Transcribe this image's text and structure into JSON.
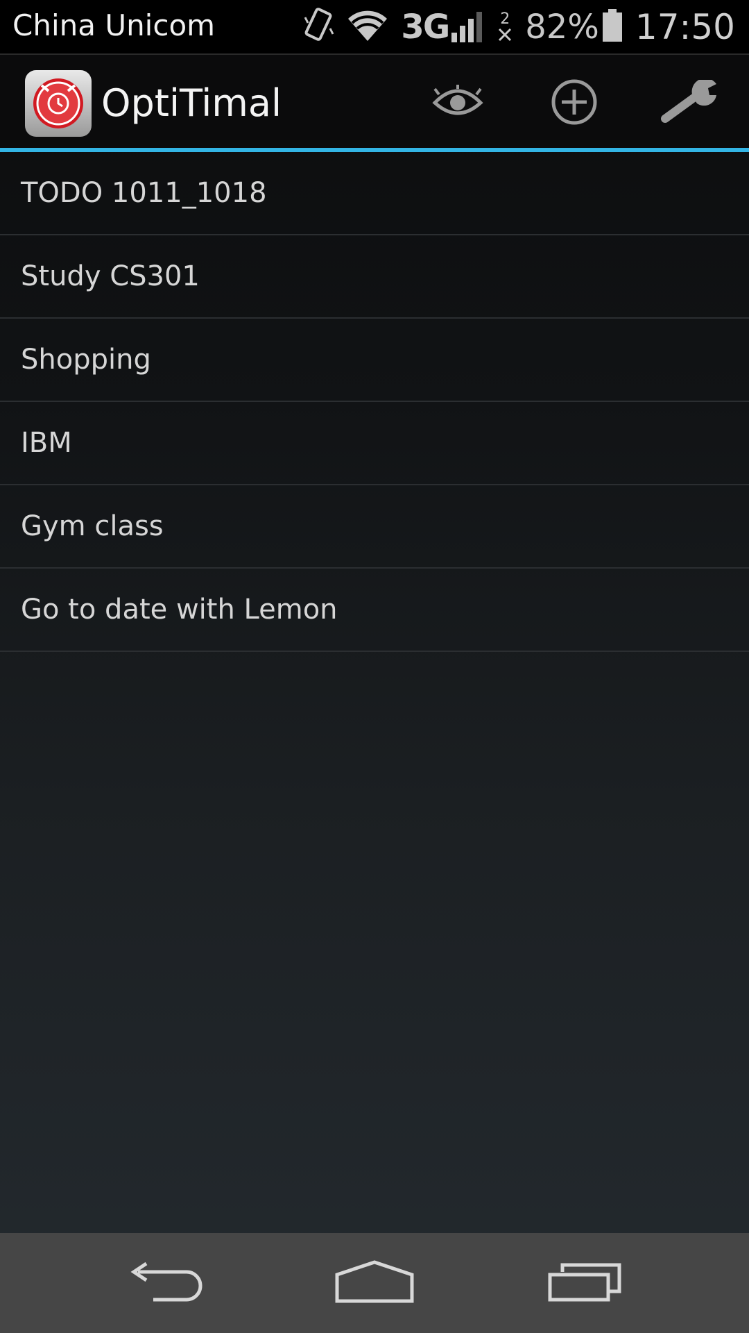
{
  "status_bar": {
    "carrier": "China Unicom",
    "network": "3G",
    "sim2_label": "2",
    "battery": "82%",
    "time": "17:50",
    "icons": [
      "vibrate-icon",
      "wifi-icon",
      "signal-icon",
      "sim2-no-signal-icon",
      "battery-icon"
    ]
  },
  "action_bar": {
    "title": "OptiTimal",
    "logo": "alarm-clock-logo",
    "actions": [
      "eye-icon",
      "add-icon",
      "wrench-icon"
    ],
    "accent_color": "#33b5e5"
  },
  "list": {
    "items": [
      {
        "label": "TODO 1011_1018"
      },
      {
        "label": "Study CS301"
      },
      {
        "label": "Shopping"
      },
      {
        "label": "IBM"
      },
      {
        "label": "Gym class"
      },
      {
        "label": "Go to date with Lemon"
      }
    ]
  },
  "nav_bar": {
    "buttons": [
      "back-icon",
      "home-icon",
      "recents-icon"
    ]
  }
}
